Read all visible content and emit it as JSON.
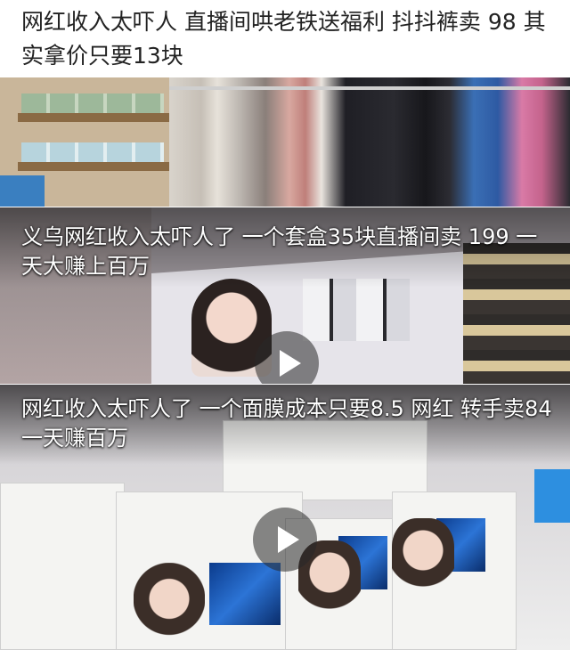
{
  "headline": {
    "text": "网红收入太吓人 直播间哄老铁送福利 抖抖裤卖 98 其实拿价只要13块"
  },
  "videos": [
    {
      "caption": "",
      "has_play_button": false
    },
    {
      "caption": "义乌网红收入太吓人了 一个套盒35块直播间卖 199 一天大赚上百万",
      "has_play_button": true
    },
    {
      "caption": "网红收入太吓人了 一个面膜成本只要8.5 网红 转手卖84 一天赚百万",
      "has_play_button": true
    }
  ],
  "icons": {
    "play": "play-icon"
  },
  "colors": {
    "headline_text": "#222222",
    "caption_text": "#ffffff",
    "background": "#ffffff"
  }
}
